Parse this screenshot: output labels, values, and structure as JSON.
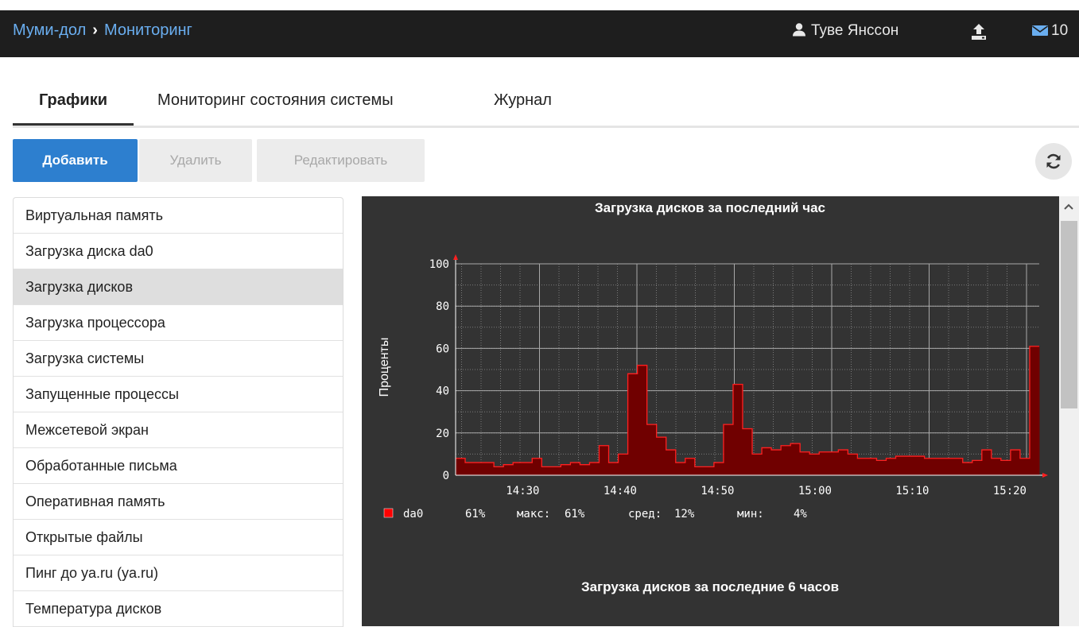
{
  "header": {
    "breadcrumb_root": "Муми-дол",
    "breadcrumb_separator": "›",
    "breadcrumb_current": "Мониторинг",
    "user_name": "Туве Янссон",
    "mail_count": "10"
  },
  "tabs": [
    {
      "label": "Графики",
      "active": true
    },
    {
      "label": "Мониторинг состояния системы",
      "active": false
    },
    {
      "label": "Журнал",
      "active": false
    }
  ],
  "toolbar": {
    "add_label": "Добавить",
    "delete_label": "Удалить",
    "edit_label": "Редактировать"
  },
  "sidebar": {
    "items": [
      {
        "label": "Виртуальная память"
      },
      {
        "label": "Загрузка диска da0"
      },
      {
        "label": "Загрузка дисков",
        "selected": true
      },
      {
        "label": "Загрузка процессора"
      },
      {
        "label": "Загрузка системы"
      },
      {
        "label": "Запущенные процессы"
      },
      {
        "label": "Межсетевой экран"
      },
      {
        "label": "Обработанные письма"
      },
      {
        "label": "Оперативная память"
      },
      {
        "label": "Открытые файлы"
      },
      {
        "label": "Пинг до ya.ru (ya.ru)"
      },
      {
        "label": "Температура дисков"
      }
    ]
  },
  "colors": {
    "topbar_bg": "#1e1e1e",
    "link": "#6aaef0",
    "accent": "#2d7fcf",
    "chart_bg": "#333333",
    "series_fill": "#700000",
    "series_line": "#ff2020",
    "legend_swatch": "#ff0000"
  },
  "icons": {
    "user": "user-icon",
    "upload": "upload-icon",
    "mail": "envelope-icon",
    "refresh": "refresh-icon"
  },
  "chart_data": [
    {
      "type": "area",
      "title": "Загрузка дисков за последний час",
      "ylabel": "Проценты",
      "ylim": [
        0,
        100
      ],
      "yticks": [
        "0",
        "20",
        "40",
        "60",
        "80",
        "100"
      ],
      "xticks": [
        "14:30",
        "14:40",
        "14:50",
        "15:00",
        "15:10",
        "15:20"
      ],
      "grid": true,
      "x_start": "14:21",
      "x_end": "15:20",
      "series": [
        {
          "name": "da0",
          "values": [
            8,
            6,
            6,
            6,
            4,
            5,
            6,
            6,
            8,
            4,
            4,
            5,
            6,
            5,
            6,
            14,
            6,
            10,
            48,
            52,
            24,
            18,
            12,
            6,
            8,
            4,
            4,
            6,
            24,
            43,
            22,
            10,
            13,
            12,
            14,
            15,
            11,
            10,
            11,
            11,
            12,
            10,
            8,
            8,
            7,
            8,
            9,
            9,
            9,
            8,
            8,
            8,
            8,
            6,
            7,
            12,
            8,
            7,
            12,
            8,
            61
          ]
        }
      ],
      "legend": {
        "name": "da0",
        "current": "61%",
        "max_label": "макс:",
        "max": "61%",
        "avg_label": "сред:",
        "avg": "12%",
        "min_label": "мин:",
        "min": "4%"
      }
    },
    {
      "type": "area",
      "title": "Загрузка дисков за последние 6 часов"
    }
  ]
}
